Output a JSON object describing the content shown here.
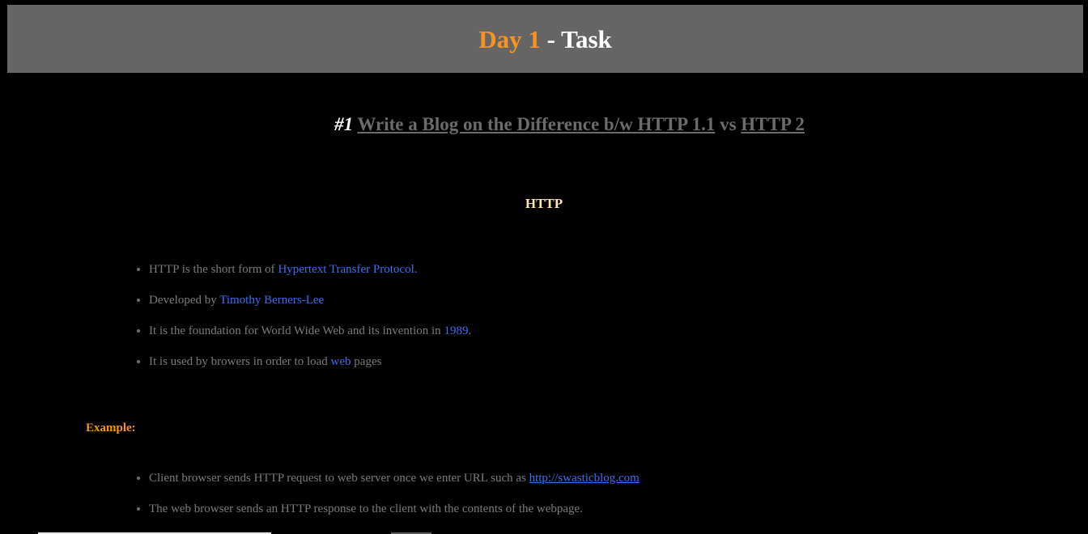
{
  "header": {
    "day_label": "Day 1",
    "separator": " - ",
    "task_label": "Task"
  },
  "task": {
    "number": "#1",
    "link1": "Write a Blog on the Difference b/w HTTP 1.1",
    "vs": "vs",
    "link2": "HTTP 2"
  },
  "http_section": {
    "heading": "HTTP",
    "items": [
      {
        "pre": "HTTP is the short form of ",
        "highlight": "Hypertext Transfer Protocol.",
        "post": ""
      },
      {
        "pre": "Developed by ",
        "highlight": "Timothy Berners-Lee",
        "post": ""
      },
      {
        "pre": "It is the foundation for World Wide Web and its invention in ",
        "highlight": "1989",
        "post": "."
      },
      {
        "pre": "It is used by browers in order to load ",
        "highlight": "web",
        "post": " pages"
      }
    ]
  },
  "example_section": {
    "label": "Example:",
    "items": [
      {
        "pre": "Client browser sends HTTP request to web server once we enter URL such as ",
        "link": "http://swasticblog.com",
        "post": ""
      },
      {
        "pre": "The web browser sends an HTTP response to the client with the contents of the webpage.",
        "link": "",
        "post": ""
      }
    ]
  },
  "colors": {
    "background": "#000000",
    "header_bg": "#656565",
    "accent_orange": "#f7931e",
    "link_blue": "#3f6df0",
    "muted_text": "#7a7a7a",
    "heading_cream": "#fde3b5"
  }
}
